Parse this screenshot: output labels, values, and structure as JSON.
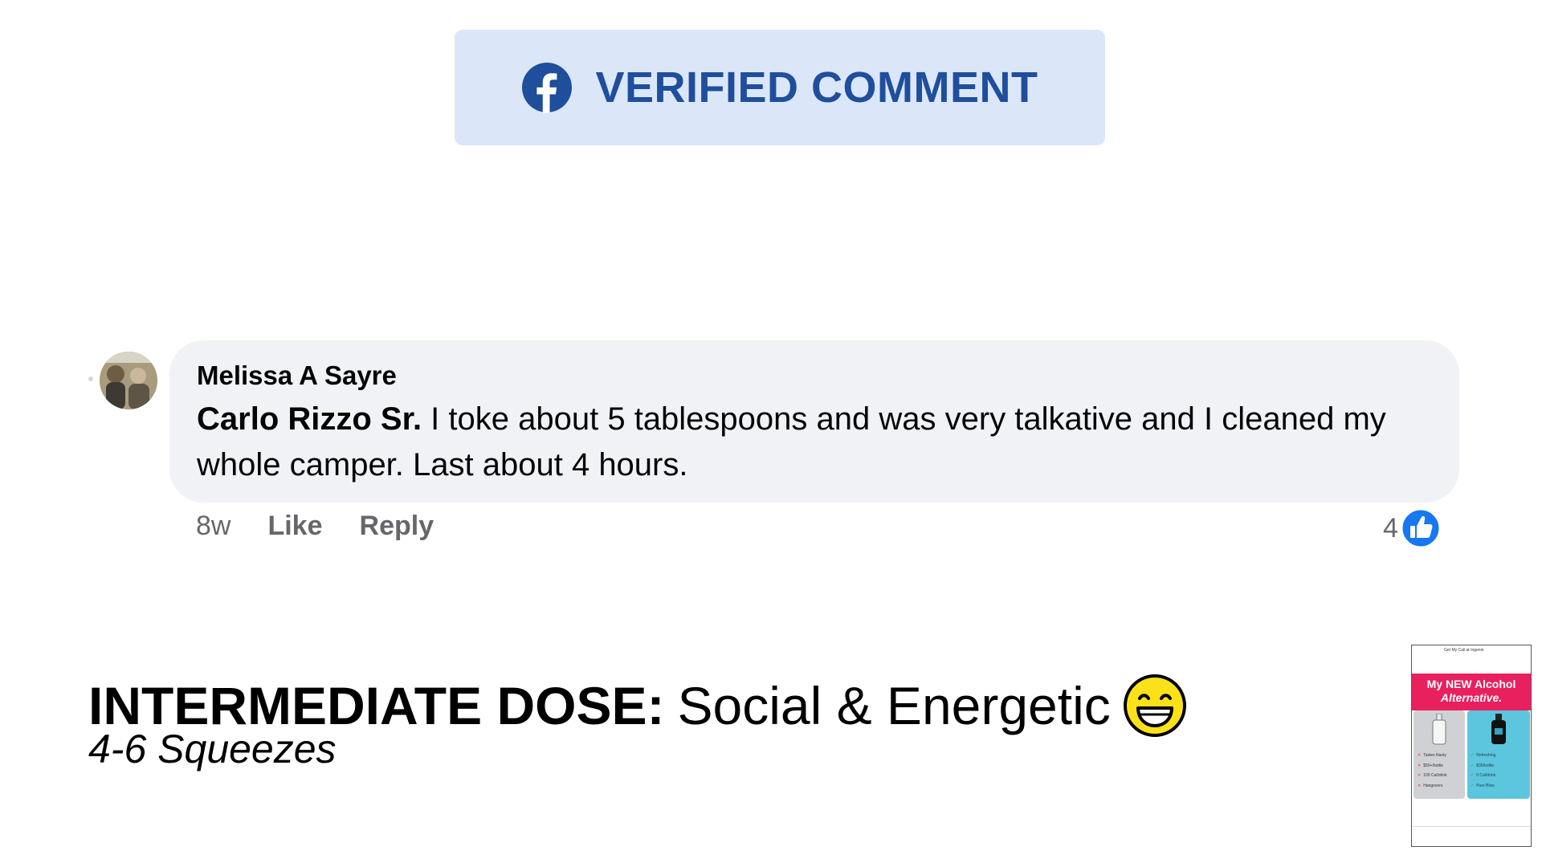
{
  "badge": {
    "icon": "facebook-icon",
    "label": "VERIFIED COMMENT",
    "background": "#dbe7f8",
    "text_color": "#1f4e9c"
  },
  "comment": {
    "avatar_icon": "avatar",
    "author": "Melissa A Sayre",
    "mention": "Carlo Rizzo Sr.",
    "text": " I toke about 5 tablespoons and was very talkative and I cleaned my whole camper. Last about 4 hours.",
    "time": "8w",
    "like_label": "Like",
    "reply_label": "Reply",
    "reaction_count": "4",
    "reaction_icon": "like-icon",
    "bubble_color": "#f0f2f5"
  },
  "dose": {
    "title_strong": "INTERMEDIATE DOSE:",
    "title_rest": "Social & Energetic",
    "emoji_icon": "grinning-face-icon",
    "subtitle": "4-6 Squeezes"
  },
  "thumbnail": {
    "header": "Get My Cali at Ingenio",
    "banner_line1": "My NEW Alcohol",
    "banner_line2": "Alternative.",
    "banner_color": "#e8215e",
    "left_items": [
      "Tastes Nasty",
      "$50+/bottle",
      "100 Cal/drink",
      "Hangovers"
    ],
    "right_items": [
      "Refreshing",
      "$35/bottle",
      "0 Cal/drink",
      "Pure Bliss"
    ]
  }
}
